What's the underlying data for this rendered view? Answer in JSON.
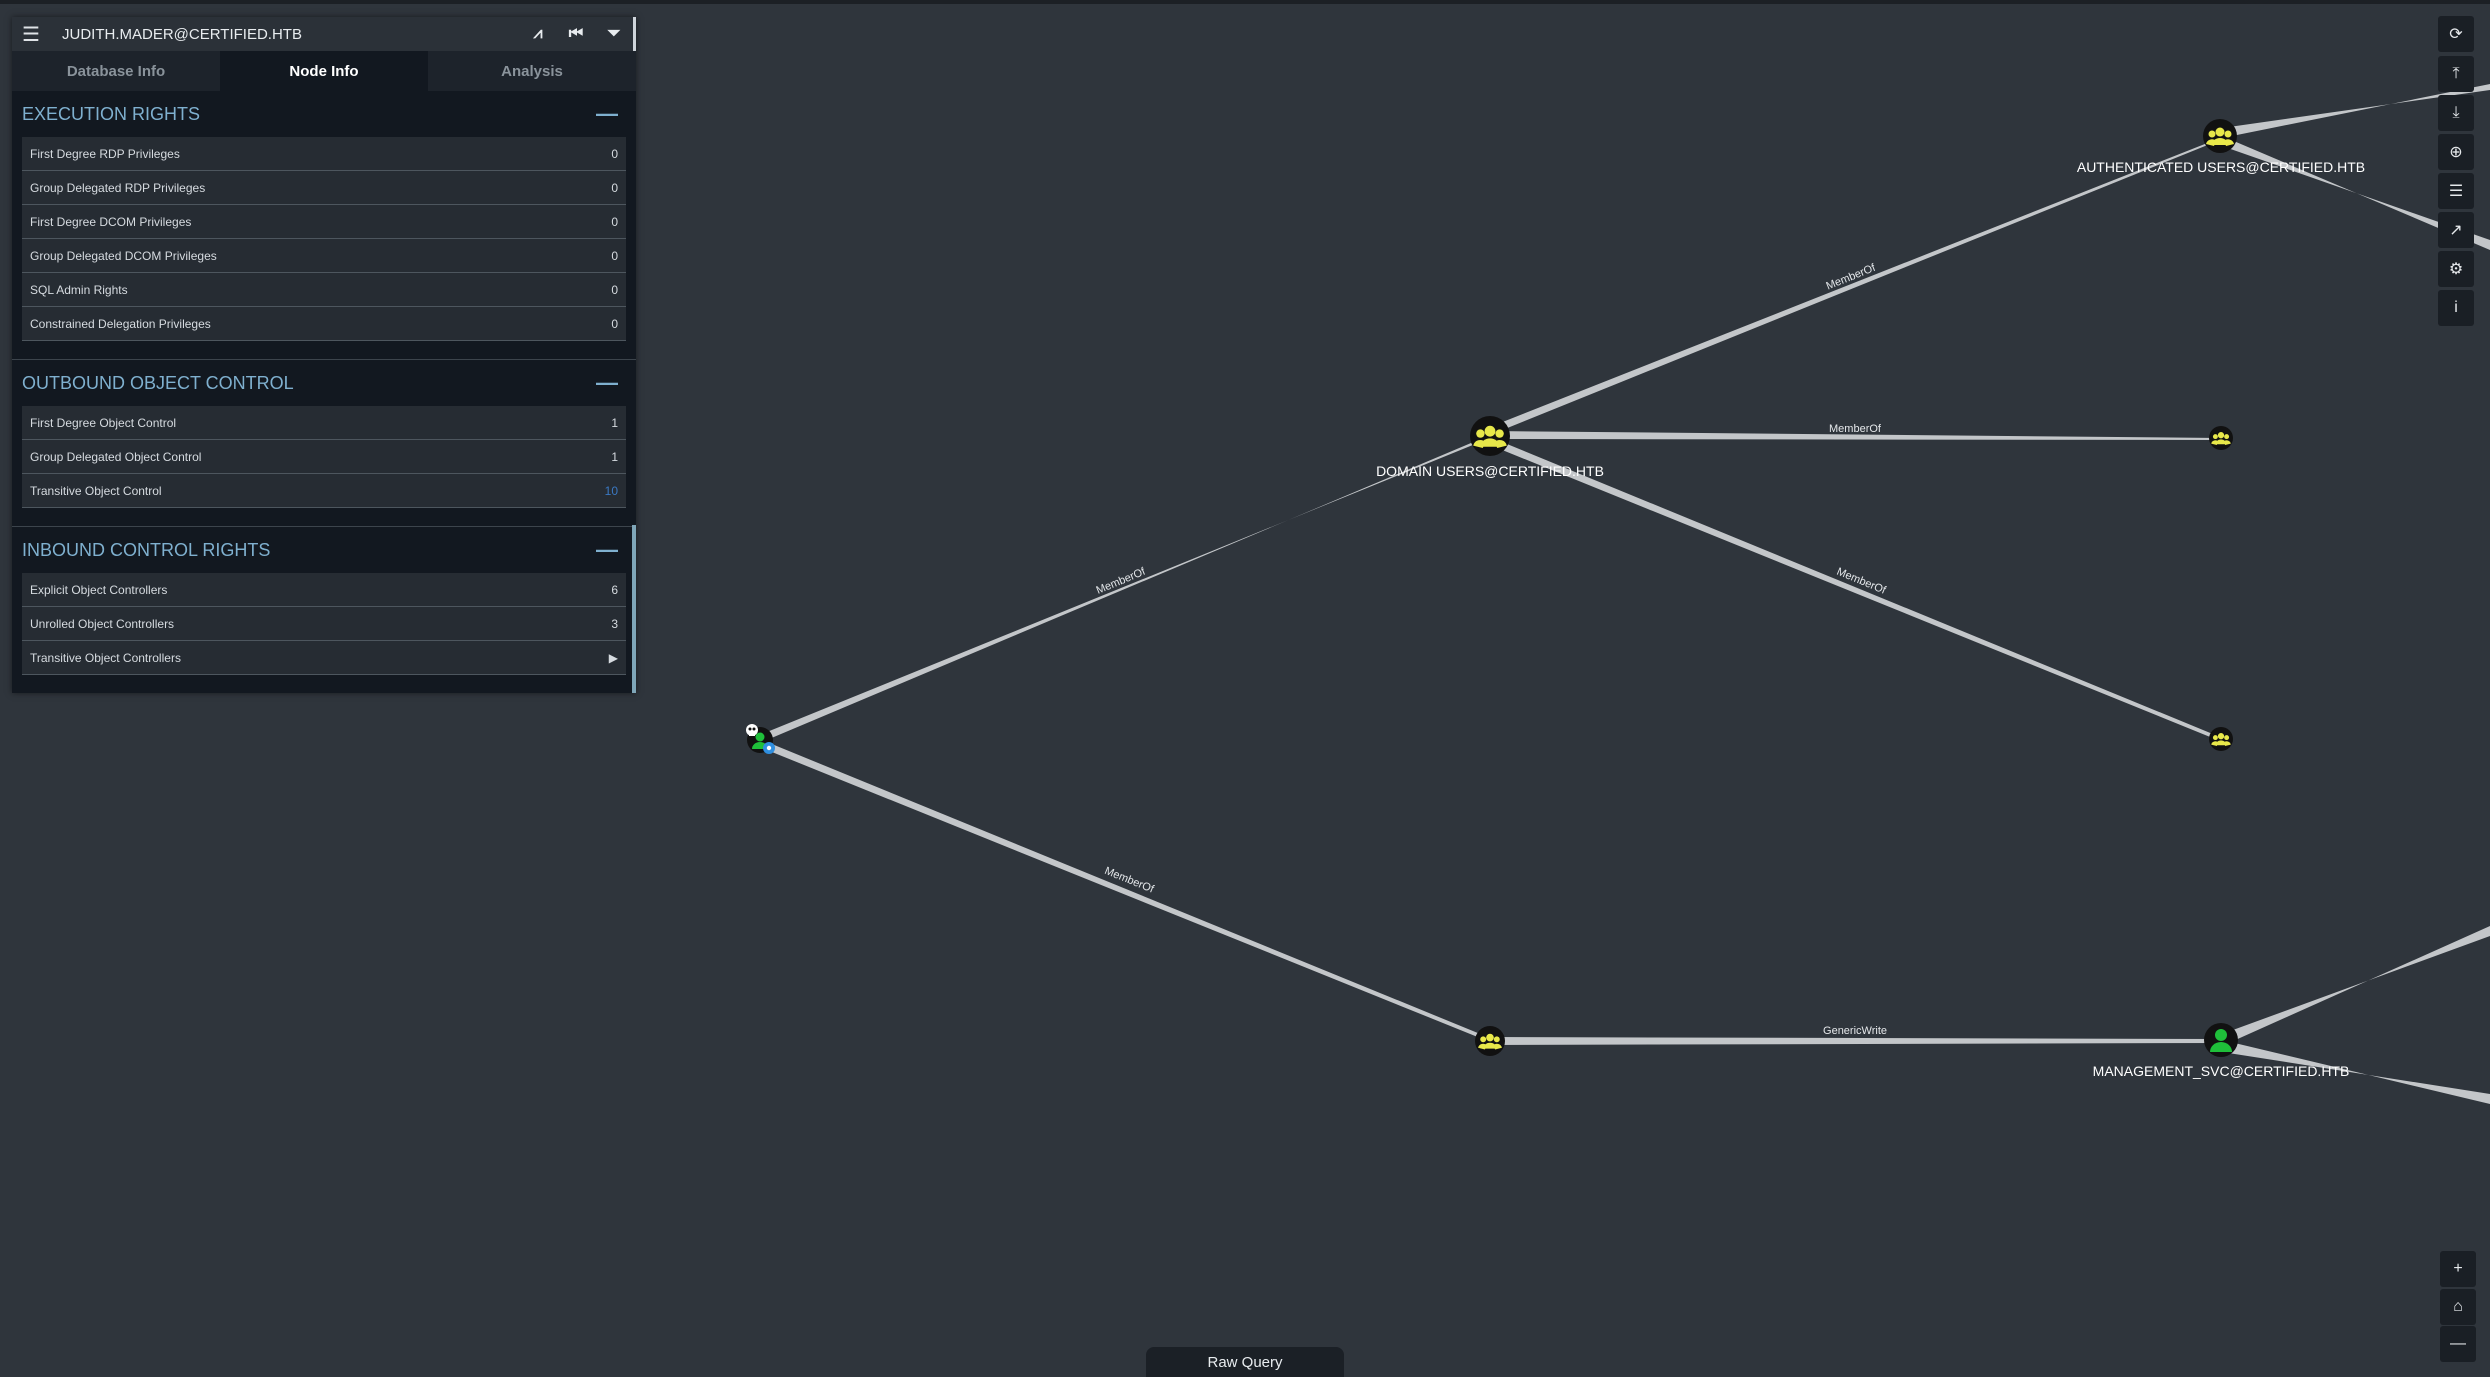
{
  "panel": {
    "title": "JUDITH.MADER@CERTIFIED.HTB",
    "tabs": [
      {
        "label": "Database Info"
      },
      {
        "label": "Node Info"
      },
      {
        "label": "Analysis"
      }
    ],
    "execution": {
      "title": "EXECUTION RIGHTS",
      "collapse": "—",
      "rows": [
        {
          "label": "First Degree RDP Privileges",
          "value": "0"
        },
        {
          "label": "Group Delegated RDP Privileges",
          "value": "0"
        },
        {
          "label": "First Degree DCOM Privileges",
          "value": "0"
        },
        {
          "label": "Group Delegated DCOM Privileges",
          "value": "0"
        },
        {
          "label": "SQL Admin Rights",
          "value": "0"
        },
        {
          "label": "Constrained Delegation Privileges",
          "value": "0"
        }
      ]
    },
    "outbound": {
      "title": "OUTBOUND OBJECT CONTROL",
      "collapse": "—",
      "rows": [
        {
          "label": "First Degree Object Control",
          "value": "1"
        },
        {
          "label": "Group Delegated Object Control",
          "value": "1"
        },
        {
          "label": "Transitive Object Control",
          "value": "10"
        }
      ]
    },
    "inbound": {
      "title": "INBOUND CONTROL RIGHTS",
      "collapse": "—",
      "rows": [
        {
          "label": "Explicit Object Controllers",
          "value": "6"
        },
        {
          "label": "Unrolled Object Controllers",
          "value": "3"
        },
        {
          "label": "Transitive Object Controllers",
          "value": "▶"
        }
      ]
    }
  },
  "graph": {
    "labels": {
      "authenticated_users": "AUTHENTICATED USERS@CERTIFIED.HTB",
      "domain_users": "DOMAIN USERS@CERTIFIED.HTB",
      "management_svc": "MANAGEMENT_SVC@CERTIFIED.HTB"
    },
    "edges": {
      "e1": "MemberOf",
      "e2": "MemberOf",
      "e3": "MemberOf",
      "e4": "MemberOf",
      "e5": "MemberOf",
      "e6": "GenericWrite"
    }
  },
  "toolbar": {
    "icons": [
      "refresh-icon",
      "upload-icon",
      "download-icon",
      "upload-circle-icon",
      "list-check-icon",
      "chart-icon",
      "settings-icon",
      "info-icon"
    ],
    "glyphs": [
      "⟳",
      "⤒",
      "⤓",
      "⊕",
      "☰",
      "↗",
      "⚙",
      "i"
    ]
  },
  "zoom": {
    "plus": "+",
    "home": "⌂",
    "minus": "—"
  },
  "raw_query": "Raw Query",
  "colors": {
    "group_node": "#e8e84a",
    "user_node": "#1fbf3a",
    "background": "#2f353c"
  }
}
